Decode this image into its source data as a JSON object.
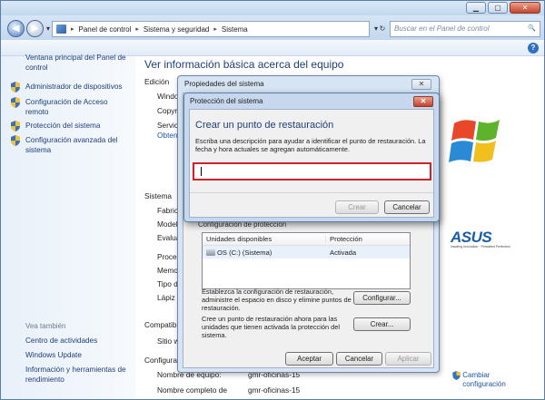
{
  "window": {
    "minimize": "▁",
    "maximize": "▢",
    "close": "✕"
  },
  "nav": {
    "back": "◀",
    "forward": "▶",
    "dropdown": "▾"
  },
  "address": {
    "segments": [
      "Panel de control",
      "Sistema y seguridad",
      "Sistema"
    ],
    "refresh": "↻",
    "dropdown": "▾"
  },
  "search": {
    "placeholder": "Buscar en el Panel de control",
    "icon": "🔍"
  },
  "help": "?",
  "sidebar": {
    "home": "Ventana principal del Panel de control",
    "items": [
      "Administrador de dispositivos",
      "Configuración de Acceso remoto",
      "Protección del sistema",
      "Configuración avanzada del sistema"
    ],
    "see_also_title": "Vea también",
    "see_also": [
      "Centro de actividades",
      "Windows Update",
      "Información y herramientas de rendimiento"
    ]
  },
  "main": {
    "title": "Ver información básica acerca del equipo",
    "edition_label": "Edición",
    "edition_rows": [
      "Windo",
      "Copyri",
      "Service",
      "Obten"
    ],
    "system_label": "Sistema",
    "system_rows": [
      "Fabrica",
      "Model",
      "Evalua",
      "Proces",
      "Memo",
      "Tipo d",
      "Lápiz y"
    ],
    "compat_label": "Compatib",
    "compat_rows": [
      "Sitio w"
    ],
    "config_label": "Configura",
    "config_rows": [
      {
        "label": "Nombre de equipo:",
        "value": "gmr-oficinas-15"
      },
      {
        "label": "Nombre completo de",
        "value": "gmr-oficinas-15"
      }
    ],
    "asus": "ASUS",
    "asus_tag": "Inspiring Innovation · Persistent Perfection",
    "cambiar": "Cambiar configuración"
  },
  "outer_dialog": {
    "title": "Propiedades del sistema",
    "close": "✕",
    "group_label": "Configuración de protección",
    "list_headers": [
      "Unidades disponibles",
      "Protección"
    ],
    "list_rows": [
      {
        "drive": "OS (C:) (Sistema)",
        "protection": "Activada"
      }
    ],
    "configure_text": "Establezca la configuración de restauración, administre el espacio en disco y elimine puntos de restauración.",
    "configure_button": "Configurar...",
    "create_text": "Cree un punto de restauración ahora para las unidades que tienen activada la protección del sistema.",
    "create_button": "Crear...",
    "ok": "Aceptar",
    "cancel": "Cancelar",
    "apply": "Aplicar"
  },
  "inner_dialog": {
    "title": "Protección del sistema",
    "close": "✕",
    "heading": "Crear un punto de restauración",
    "description": "Escriba una descripción para ayudar a identificar el punto de restauración. La fecha y hora actuales se agregan automáticamente.",
    "input_value": "",
    "create": "Crear",
    "cancel": "Cancelar"
  },
  "colors": {
    "highlight": "#d0202c",
    "link": "#1f55a8",
    "heading": "#1e3f7a"
  }
}
